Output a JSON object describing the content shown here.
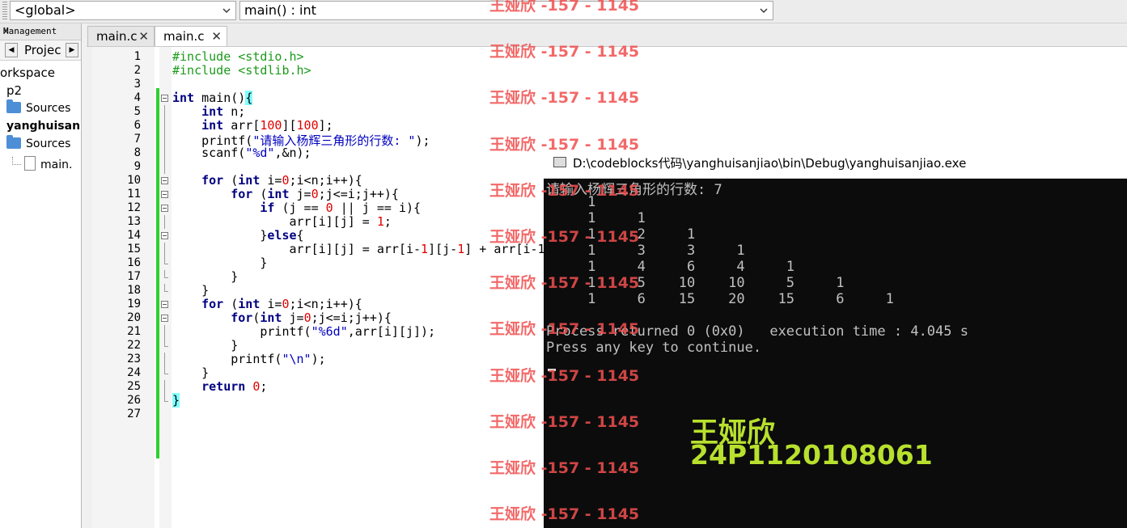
{
  "toolbar": {
    "scope_combo": "<global>",
    "function_combo": "main() : int"
  },
  "management": {
    "title": "Management",
    "close_label": "✕",
    "tab_left": "◀",
    "tab_label": "Projec",
    "tab_right": "▶",
    "tree": [
      {
        "label": "orkspace",
        "kind": "text"
      },
      {
        "label": "p2",
        "kind": "text"
      },
      {
        "label": "Sources",
        "kind": "folder"
      },
      {
        "label": "yanghuisan",
        "kind": "bold"
      },
      {
        "label": "Sources",
        "kind": "folder"
      },
      {
        "label": "main.",
        "kind": "file"
      }
    ]
  },
  "editor": {
    "tabs": [
      {
        "label": "main.c",
        "close": "✕",
        "active": false
      },
      {
        "label": "main.c",
        "close": "✕",
        "active": true
      }
    ],
    "line_numbers": [
      "1",
      "2",
      "3",
      "4",
      "5",
      "6",
      "7",
      "8",
      "9",
      "10",
      "11",
      "12",
      "13",
      "14",
      "15",
      "16",
      "17",
      "18",
      "19",
      "20",
      "21",
      "22",
      "23",
      "24",
      "25",
      "26",
      "27"
    ],
    "lines": [
      [
        {
          "t": "#include <stdio.h>",
          "c": "#1a9a1a"
        }
      ],
      [
        {
          "t": "#include <stdlib.h>",
          "c": "#1a9a1a"
        }
      ],
      [],
      [
        {
          "t": "int",
          "c": "#000080",
          "b": true
        },
        {
          "t": " main()",
          "c": "#000"
        },
        {
          "t": "{",
          "c": "#000",
          "bg": "#80ffff"
        }
      ],
      [
        {
          "t": "    ",
          "c": "#000"
        },
        {
          "t": "int",
          "c": "#000080",
          "b": true
        },
        {
          "t": " n;",
          "c": "#000"
        }
      ],
      [
        {
          "t": "    ",
          "c": "#000"
        },
        {
          "t": "int",
          "c": "#000080",
          "b": true
        },
        {
          "t": " arr[",
          "c": "#000"
        },
        {
          "t": "100",
          "c": "#e00000"
        },
        {
          "t": "][",
          "c": "#000"
        },
        {
          "t": "100",
          "c": "#e00000"
        },
        {
          "t": "];",
          "c": "#000"
        }
      ],
      [
        {
          "t": "    printf(",
          "c": "#000"
        },
        {
          "t": "\"请输入杨辉三角形的行数: \"",
          "c": "#0000c0"
        },
        {
          "t": ");",
          "c": "#000"
        }
      ],
      [
        {
          "t": "    scanf(",
          "c": "#000"
        },
        {
          "t": "\"%d\"",
          "c": "#0000c0"
        },
        {
          "t": ",&n);",
          "c": "#000"
        }
      ],
      [],
      [
        {
          "t": "    ",
          "c": "#000"
        },
        {
          "t": "for",
          "c": "#000080",
          "b": true
        },
        {
          "t": " (",
          "c": "#000"
        },
        {
          "t": "int",
          "c": "#000080",
          "b": true
        },
        {
          "t": " i=",
          "c": "#000"
        },
        {
          "t": "0",
          "c": "#e00000"
        },
        {
          "t": ";i<n;i++){",
          "c": "#000"
        }
      ],
      [
        {
          "t": "        ",
          "c": "#000"
        },
        {
          "t": "for",
          "c": "#000080",
          "b": true
        },
        {
          "t": " (",
          "c": "#000"
        },
        {
          "t": "int",
          "c": "#000080",
          "b": true
        },
        {
          "t": " j=",
          "c": "#000"
        },
        {
          "t": "0",
          "c": "#e00000"
        },
        {
          "t": ";j<=i;j++){",
          "c": "#000"
        }
      ],
      [
        {
          "t": "            ",
          "c": "#000"
        },
        {
          "t": "if",
          "c": "#000080",
          "b": true
        },
        {
          "t": " (j == ",
          "c": "#000"
        },
        {
          "t": "0",
          "c": "#e00000"
        },
        {
          "t": " || j == i){",
          "c": "#000"
        }
      ],
      [
        {
          "t": "                arr[i][j] = ",
          "c": "#000"
        },
        {
          "t": "1",
          "c": "#e00000"
        },
        {
          "t": ";",
          "c": "#000"
        }
      ],
      [
        {
          "t": "            }",
          "c": "#000"
        },
        {
          "t": "else",
          "c": "#000080",
          "b": true
        },
        {
          "t": "{",
          "c": "#000"
        }
      ],
      [
        {
          "t": "                arr[i][j] = arr[i-",
          "c": "#000"
        },
        {
          "t": "1",
          "c": "#e00000"
        },
        {
          "t": "][j-",
          "c": "#000"
        },
        {
          "t": "1",
          "c": "#e00000"
        },
        {
          "t": "] + arr[i-1",
          "c": "#000"
        }
      ],
      [
        {
          "t": "            }",
          "c": "#000"
        }
      ],
      [
        {
          "t": "        }",
          "c": "#000"
        }
      ],
      [
        {
          "t": "    }",
          "c": "#000"
        }
      ],
      [
        {
          "t": "    ",
          "c": "#000"
        },
        {
          "t": "for",
          "c": "#000080",
          "b": true
        },
        {
          "t": " (",
          "c": "#000"
        },
        {
          "t": "int",
          "c": "#000080",
          "b": true
        },
        {
          "t": " i=",
          "c": "#000"
        },
        {
          "t": "0",
          "c": "#e00000"
        },
        {
          "t": ";i<n;i++){",
          "c": "#000"
        }
      ],
      [
        {
          "t": "        ",
          "c": "#000"
        },
        {
          "t": "for",
          "c": "#000080",
          "b": true
        },
        {
          "t": "(",
          "c": "#000"
        },
        {
          "t": "int",
          "c": "#000080",
          "b": true
        },
        {
          "t": " j=",
          "c": "#000"
        },
        {
          "t": "0",
          "c": "#e00000"
        },
        {
          "t": ";j<=i;j++){",
          "c": "#000"
        }
      ],
      [
        {
          "t": "            printf(",
          "c": "#000"
        },
        {
          "t": "\"%6d\"",
          "c": "#0000c0"
        },
        {
          "t": ",arr[i][j]);",
          "c": "#000"
        }
      ],
      [
        {
          "t": "        }",
          "c": "#000"
        }
      ],
      [
        {
          "t": "        printf(",
          "c": "#000"
        },
        {
          "t": "\"\\n\"",
          "c": "#0000c0"
        },
        {
          "t": ");",
          "c": "#000"
        }
      ],
      [
        {
          "t": "    }",
          "c": "#000"
        }
      ],
      [
        {
          "t": "    ",
          "c": "#000"
        },
        {
          "t": "return",
          "c": "#000080",
          "b": true
        },
        {
          "t": " ",
          "c": "#000"
        },
        {
          "t": "0",
          "c": "#e00000"
        },
        {
          "t": ";",
          "c": "#000"
        }
      ],
      [
        {
          "t": "}",
          "c": "#000",
          "bg": "#80ffff"
        }
      ],
      []
    ]
  },
  "console": {
    "title": "D:\\codeblocks代码\\yanghuisanjiao\\bin\\Debug\\yanghuisanjiao.exe",
    "lines": [
      "请输入杨辉三角形的行数: 7",
      "     1",
      "     1     1",
      "     1     2     1",
      "     1     3     3     1",
      "     1     4     6     4     1",
      "     1     5    10    10     5     1",
      "     1     6    15    20    15     6     1",
      "",
      "Process returned 0 (0x0)   execution time : 4.045 s",
      "Press any key to continue."
    ],
    "stamp_name": "王娅欣",
    "stamp_id": "24P1120108061"
  },
  "watermark": {
    "texts": [
      "王娅欣 -157 - 1145",
      "王娅欣 -157 - 1145",
      "王娅欣 -157 - 1145",
      "王娅欣 -157 - 1145",
      "王娅欣 -157 - 1145",
      "王娅欣 -157 - 1145",
      "王娅欣 -157 - 1145",
      "王娅欣 -157 - 1145",
      "王娅欣 -157 - 1145",
      "王娅欣 -157 - 1145",
      "王娅欣 -157 - 1145",
      "王娅欣 -157 - 1145"
    ],
    "color": "#f05050"
  }
}
